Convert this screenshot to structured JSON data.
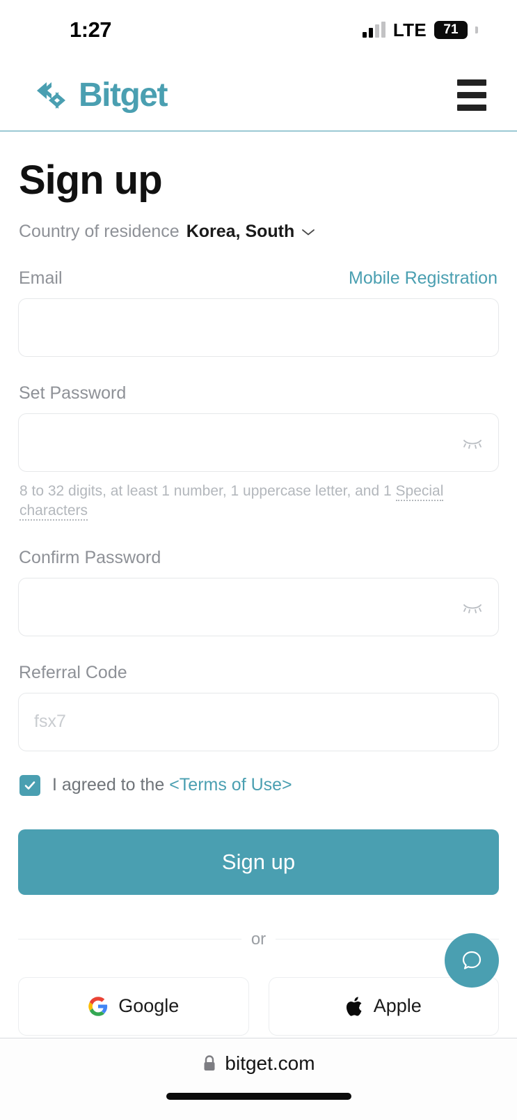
{
  "status_bar": {
    "time": "1:27",
    "carrier": "LTE",
    "battery_percent": "71",
    "signal_icon": "cellular-signal-icon",
    "battery_icon": "battery-icon"
  },
  "header": {
    "brand": "Bitget",
    "logo_icon": "bitget-swap-arrows-logo",
    "menu_icon": "hamburger-menu-icon",
    "accent_color": "#4a9fb1"
  },
  "page": {
    "title": "Sign up"
  },
  "country": {
    "label": "Country of residence",
    "value": "Korea, South",
    "chevron_icon": "chevron-down-icon"
  },
  "email_field": {
    "label": "Email",
    "alt_link": "Mobile Registration",
    "value": "",
    "placeholder": ""
  },
  "password_field": {
    "label": "Set Password",
    "value": "",
    "placeholder": "",
    "toggle_icon": "eye-off-icon",
    "hint_main": "8 to 32 digits, at least 1 number, 1 uppercase letter, and 1 ",
    "hint_spelled": "Special characters"
  },
  "confirm_password_field": {
    "label": "Confirm Password",
    "value": "",
    "placeholder": "",
    "toggle_icon": "eye-off-icon"
  },
  "referral_field": {
    "label": "Referral Code",
    "value": "",
    "placeholder": "fsx7"
  },
  "agreement": {
    "checked": true,
    "text": "I agreed to the ",
    "terms_link": "<Terms of Use>",
    "check_icon": "checkmark-icon"
  },
  "primary_action": {
    "label": "Sign up",
    "color": "#4a9fb1"
  },
  "divider": {
    "label": "or"
  },
  "social_logins": [
    {
      "label": "Google",
      "icon": "google-g-icon"
    },
    {
      "label": "Apple",
      "icon": "apple-logo-icon"
    }
  ],
  "support": {
    "icon": "chat-bubble-icon",
    "color": "#4a9fb1"
  },
  "browser": {
    "lock_icon": "lock-icon",
    "url": "bitget.com"
  }
}
